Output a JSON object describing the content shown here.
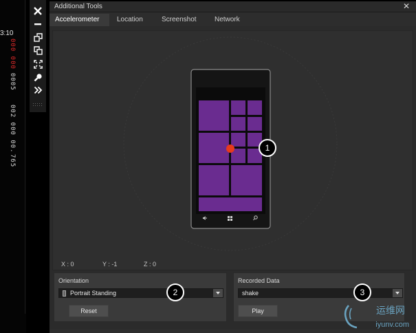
{
  "emulator": {
    "time": "3:10",
    "counters": [
      {
        "text": "000 000",
        "color": "#e02a2a"
      },
      {
        "text": "0005 ",
        "color": "#d8d8d8"
      },
      {
        "text": "002 000 00.",
        "color": "#d8d8d8"
      },
      {
        "text": "765",
        "color": "#d8d8d8"
      }
    ]
  },
  "toolbar": {
    "buttons": [
      {
        "name": "close-icon",
        "glyph": "close"
      },
      {
        "name": "minimize-icon",
        "glyph": "minus"
      },
      {
        "name": "rotate-left-icon",
        "glyph": "rot"
      },
      {
        "name": "rotate-right-icon",
        "glyph": "rot2"
      },
      {
        "name": "fit-to-screen-icon",
        "glyph": "fit"
      },
      {
        "name": "zoom-icon",
        "glyph": "zoom"
      },
      {
        "name": "additional-tools-icon",
        "glyph": "chev"
      }
    ]
  },
  "window": {
    "title": "Additional Tools",
    "close_glyph": "✕",
    "tabs": [
      {
        "label": "Accelerometer",
        "active": true
      },
      {
        "label": "Location",
        "active": false
      },
      {
        "label": "Screenshot",
        "active": false
      },
      {
        "label": "Network",
        "active": false
      }
    ]
  },
  "accelerometer": {
    "x_label": "X : 0",
    "y_label": "Y : -1",
    "z_label": "Z : 0",
    "phone_nav_icons": [
      "back-icon",
      "windows-start-icon",
      "search-icon"
    ]
  },
  "orientation": {
    "group_label": "Orientation",
    "selected": "Portrait Standing",
    "reset_label": "Reset"
  },
  "recorded": {
    "group_label": "Recorded Data",
    "selected": "shake",
    "play_label": "Play"
  },
  "callouts": [
    "1",
    "2",
    "3"
  ],
  "watermark": {
    "text_cn": "运维网",
    "text_en": "iyunv.com"
  },
  "colors": {
    "tile_purple": "#6a2c90",
    "dot_red": "#e8391c",
    "counter_red": "#e02a2a",
    "watermark_blue": "#6aa3c0"
  }
}
